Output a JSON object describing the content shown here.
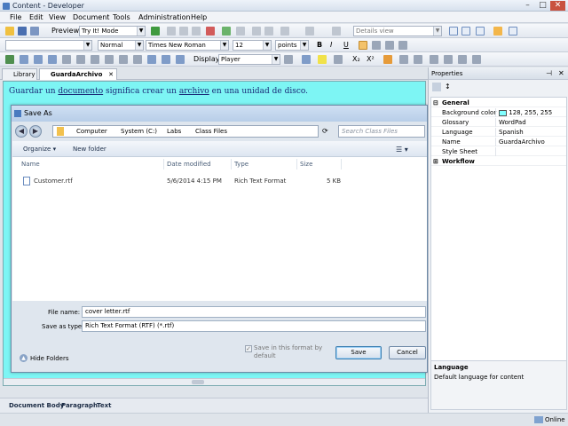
{
  "window": {
    "title": "Content - Developer",
    "minimize": "–",
    "maximize": "□",
    "close": "✕"
  },
  "menu": [
    "File",
    "Edit",
    "View",
    "Document",
    "Tools",
    "Administration",
    "Help"
  ],
  "toolbar1": {
    "preview_label": "Preview:",
    "preview_mode": "Try It! Mode",
    "details_view": "Details view"
  },
  "toolbar2": {
    "style": "Normal",
    "font": "Times New Roman",
    "size": "12",
    "unit": "points",
    "bold": "B",
    "italic": "I",
    "underline": "U"
  },
  "toolbar3": {
    "display_label": "Display:",
    "display_value": "Player",
    "subscript": "X₂",
    "superscript": "X²"
  },
  "tabs": [
    {
      "label": "Library"
    },
    {
      "label": "GuardaArchivo",
      "close": "✕"
    }
  ],
  "editor": {
    "text_before": "Guardar un ",
    "link1": "documento",
    "text_mid": " significa crear un ",
    "link2": "archivo",
    "text_after": " en una unidad de disco."
  },
  "dialog": {
    "title": "Save As",
    "close": "✕",
    "breadcrumb": [
      "Computer",
      "System (C:)",
      "Labs",
      "Class Files"
    ],
    "search_placeholder": "Search Class Files",
    "organize": "Organize ▾",
    "new_folder": "New folder",
    "columns": [
      "Name",
      "Date modified",
      "Type",
      "Size"
    ],
    "files": [
      {
        "name": "Customer.rtf",
        "date": "5/6/2014 4:15 PM",
        "type": "Rich Text Format",
        "size": "5 KB"
      }
    ],
    "file_name_label": "File name:",
    "file_name": "cover letter.rtf",
    "save_type_label": "Save as type:",
    "save_type": "Rich Text Format (RTF) (*.rtf)",
    "checkbox_label": "Save in this format by default",
    "hide_folders": "Hide Folders",
    "save": "Save",
    "cancel": "Cancel"
  },
  "properties": {
    "title": "Properties",
    "category_general": "General",
    "rows": [
      {
        "key": "Background color",
        "value": "128, 255, 255"
      },
      {
        "key": "Glossary",
        "value": "WordPad"
      },
      {
        "key": "Language",
        "value": "Spanish"
      },
      {
        "key": "Name",
        "value": "GuardaArchivo"
      },
      {
        "key": "Style Sheet",
        "value": ""
      }
    ],
    "category_workflow": "Workflow",
    "desc_title": "Language",
    "desc_text": "Default language for content",
    "swatch_color": "#80ffff"
  },
  "status": [
    "Document Body",
    "Paragraph",
    "Text"
  ],
  "online": "Online"
}
